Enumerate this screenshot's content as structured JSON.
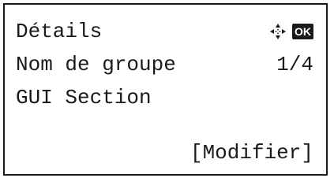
{
  "screen": {
    "title": "Détails",
    "row2": {
      "label": "Nom de groupe",
      "page": "1/4"
    },
    "row3": {
      "value": "GUI Section"
    },
    "softkey_label": "[Modifier]"
  },
  "icons": {
    "navigation": "four-way-navigation-icon",
    "ok": "OK"
  },
  "colors": {
    "foreground": "#1a1a1a",
    "background": "#ffffff"
  }
}
